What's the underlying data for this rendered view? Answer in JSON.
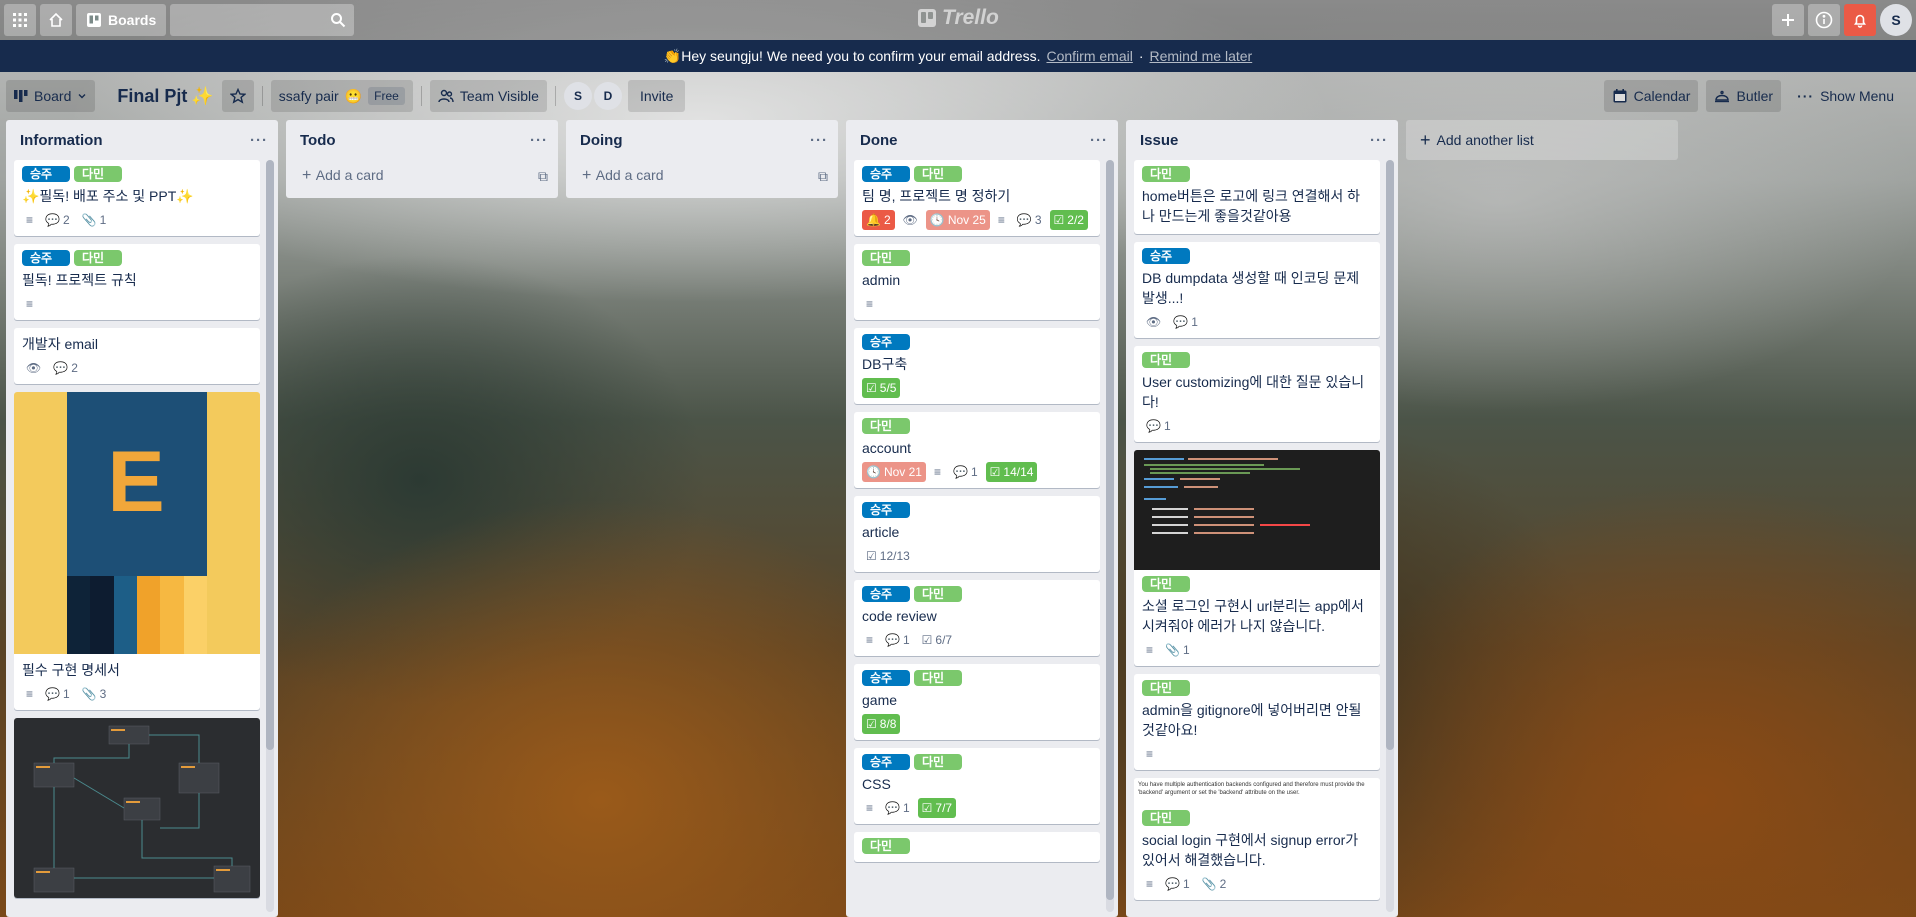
{
  "topbar": {
    "boards_label": "Boards",
    "logo_text": "Trello",
    "avatar_initial": "S",
    "notif_color": "#eb5a46"
  },
  "banner": {
    "message": "👏Hey seungju! We need you to confirm your email address.",
    "confirm_link": "Confirm email",
    "separator": "·",
    "remind_link": "Remind me later"
  },
  "boardbar": {
    "view_label": "Board",
    "board_title": "Final Pjt",
    "board_emoji": "✨",
    "team_name": "ssafy pair",
    "team_emoji": "😬",
    "free_label": "Free",
    "visibility_label": "Team Visible",
    "members": [
      "S",
      "D"
    ],
    "invite_label": "Invite",
    "calendar_label": "Calendar",
    "butler_label": "Butler",
    "show_menu_label": "Show Menu"
  },
  "lists": [
    {
      "title": "Information",
      "cards": [
        {
          "labels": [
            {
              "text": "승주",
              "color": "blue"
            },
            {
              "text": "다민",
              "color": "green"
            }
          ],
          "title": "✨필독! 배포 주소 및 PPT✨",
          "badges": [
            {
              "icon": "description-icon",
              "text": ""
            },
            {
              "icon": "comment-icon",
              "text": "2"
            },
            {
              "icon": "attachment-icon",
              "text": "1"
            }
          ]
        },
        {
          "labels": [
            {
              "text": "승주",
              "color": "blue"
            },
            {
              "text": "다민",
              "color": "green"
            }
          ],
          "title": "필독! 프로젝트 규칙",
          "badges": [
            {
              "icon": "description-icon",
              "text": ""
            }
          ]
        },
        {
          "labels": [],
          "title": "개발자 email",
          "badges": [
            {
              "icon": "watch-icon",
              "text": ""
            },
            {
              "icon": "comment-icon",
              "text": "2"
            }
          ]
        },
        {
          "labels": [],
          "title": "필수 구현 명세서",
          "image": "letter-e-cover",
          "image_letter": "E",
          "badges": [
            {
              "icon": "description-icon",
              "text": ""
            },
            {
              "icon": "comment-icon",
              "text": "1"
            },
            {
              "icon": "attachment-icon",
              "text": "3"
            }
          ]
        },
        {
          "labels": [],
          "title": "",
          "image": "erd-diagram",
          "badges": []
        }
      ]
    },
    {
      "title": "Todo",
      "add_card": "Add a card"
    },
    {
      "title": "Doing",
      "add_card": "Add a card"
    },
    {
      "title": "Done",
      "cards": [
        {
          "labels": [
            {
              "text": "승주",
              "color": "blue"
            },
            {
              "text": "다민",
              "color": "green"
            }
          ],
          "title": "팀 명, 프로젝트 명 정하기",
          "badges": [
            {
              "icon": "bell-icon",
              "text": "2",
              "style": "red"
            },
            {
              "icon": "watch-icon",
              "text": ""
            },
            {
              "icon": "clock-icon",
              "text": "Nov 25",
              "style": "pink"
            },
            {
              "icon": "description-icon",
              "text": ""
            },
            {
              "icon": "comment-icon",
              "text": "3"
            },
            {
              "icon": "checklist-icon",
              "text": "2/2",
              "style": "done"
            }
          ]
        },
        {
          "labels": [
            {
              "text": "다민",
              "color": "green"
            }
          ],
          "title": "admin",
          "badges": [
            {
              "icon": "description-icon",
              "text": ""
            }
          ]
        },
        {
          "labels": [
            {
              "text": "승주",
              "color": "blue"
            }
          ],
          "title": "DB구축",
          "badges": [
            {
              "icon": "checklist-icon",
              "text": "5/5",
              "style": "done"
            }
          ]
        },
        {
          "labels": [
            {
              "text": "다민",
              "color": "green"
            }
          ],
          "title": "account",
          "badges": [
            {
              "icon": "clock-icon",
              "text": "Nov 21",
              "style": "pink"
            },
            {
              "icon": "description-icon",
              "text": ""
            },
            {
              "icon": "comment-icon",
              "text": "1"
            },
            {
              "icon": "checklist-icon",
              "text": "14/14",
              "style": "done"
            }
          ]
        },
        {
          "labels": [
            {
              "text": "승주",
              "color": "blue"
            }
          ],
          "title": "article",
          "badges": [
            {
              "icon": "checklist-icon",
              "text": "12/13"
            }
          ]
        },
        {
          "labels": [
            {
              "text": "승주",
              "color": "blue"
            },
            {
              "text": "다민",
              "color": "green"
            }
          ],
          "title": "code review",
          "badges": [
            {
              "icon": "description-icon",
              "text": ""
            },
            {
              "icon": "comment-icon",
              "text": "1"
            },
            {
              "icon": "checklist-icon",
              "text": "6/7"
            }
          ]
        },
        {
          "labels": [
            {
              "text": "승주",
              "color": "blue"
            },
            {
              "text": "다민",
              "color": "green"
            }
          ],
          "title": "game",
          "badges": [
            {
              "icon": "checklist-icon",
              "text": "8/8",
              "style": "done"
            }
          ]
        },
        {
          "labels": [
            {
              "text": "승주",
              "color": "blue"
            },
            {
              "text": "다민",
              "color": "green"
            }
          ],
          "title": "CSS",
          "badges": [
            {
              "icon": "description-icon",
              "text": ""
            },
            {
              "icon": "comment-icon",
              "text": "1"
            },
            {
              "icon": "checklist-icon",
              "text": "7/7",
              "style": "done"
            }
          ]
        },
        {
          "labels": [
            {
              "text": "다민",
              "color": "green"
            }
          ],
          "title": "",
          "badges": []
        }
      ]
    },
    {
      "title": "Issue",
      "cards": [
        {
          "labels": [
            {
              "text": "다민",
              "color": "green"
            }
          ],
          "title": "home버튼은 로고에 링크 연결해서 하나 만드는게 좋을것같아용",
          "badges": []
        },
        {
          "labels": [
            {
              "text": "승주",
              "color": "blue"
            }
          ],
          "title": "DB dumpdata 생성할 때 인코딩 문제 발생...!",
          "badges": [
            {
              "icon": "watch-icon",
              "text": ""
            },
            {
              "icon": "comment-icon",
              "text": "1"
            }
          ]
        },
        {
          "labels": [
            {
              "text": "다민",
              "color": "green"
            }
          ],
          "title": "User customizing에 대한 질문 있습니다!",
          "badges": [
            {
              "icon": "comment-icon",
              "text": "1"
            }
          ]
        },
        {
          "labels": [
            {
              "text": "다민",
              "color": "green"
            }
          ],
          "title": "소셜 로그인 구현시 url분리는 app에서 시켜줘야 에러가 나지 않습니다.",
          "image": "code-screenshot",
          "badges": [
            {
              "icon": "description-icon",
              "text": ""
            },
            {
              "icon": "attachment-icon",
              "text": "1"
            }
          ]
        },
        {
          "labels": [
            {
              "text": "다민",
              "color": "green"
            }
          ],
          "title": "admin을 gitignore에 넣어버리면 안될것같아요!",
          "badges": [
            {
              "icon": "description-icon",
              "text": ""
            }
          ]
        },
        {
          "labels": [
            {
              "text": "다민",
              "color": "green"
            }
          ],
          "title": "social login 구현에서 signup error가 있어서 해결했습니다.",
          "image": "error-text",
          "image_text": "You have multiple authentication backends configured and therefore must provide the 'backend' argument or set the 'backend' attribute on the user.",
          "badges": [
            {
              "icon": "description-icon",
              "text": ""
            },
            {
              "icon": "comment-icon",
              "text": "1"
            },
            {
              "icon": "attachment-icon",
              "text": "2"
            }
          ]
        }
      ]
    }
  ],
  "add_list_label": "Add another list",
  "colors": {
    "label_blue": "#0079bf",
    "label_green": "#61bd4f",
    "banner_bg": "#172b4d",
    "list_bg": "#ebecf0"
  }
}
